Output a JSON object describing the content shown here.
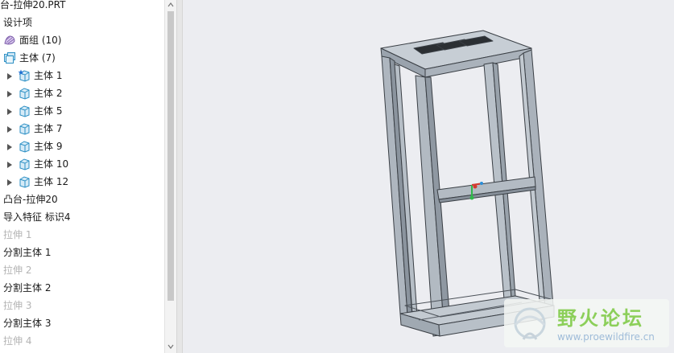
{
  "model_tree": {
    "items": [
      {
        "label": "台-拉伸20.PRT",
        "dim": false
      },
      {
        "label": "设计项",
        "dim": false
      },
      {
        "label": "面组 (10)",
        "dim": false
      },
      {
        "label": "主体 (7)",
        "dim": false
      },
      {
        "label": "主体 1",
        "dim": false
      },
      {
        "label": "主体 2",
        "dim": false
      },
      {
        "label": "主体 5",
        "dim": false
      },
      {
        "label": "主体 7",
        "dim": false
      },
      {
        "label": "主体 9",
        "dim": false
      },
      {
        "label": "主体 10",
        "dim": false
      },
      {
        "label": "主体 12",
        "dim": false
      },
      {
        "label": "凸台-拉伸20",
        "dim": false
      },
      {
        "label": "导入特征 标识4",
        "dim": false
      },
      {
        "label": "拉伸 1",
        "dim": true
      },
      {
        "label": "分割主体 1",
        "dim": false
      },
      {
        "label": "拉伸 2",
        "dim": true
      },
      {
        "label": "分割主体 2",
        "dim": false
      },
      {
        "label": "拉伸 3",
        "dim": true
      },
      {
        "label": "分割主体 3",
        "dim": false
      },
      {
        "label": "拉伸 4",
        "dim": true
      }
    ]
  },
  "icons": {
    "quilt": "quilt-icon",
    "body_group": "body-group-icon",
    "body": "body-icon",
    "body_active": "active-body-icon",
    "expand": "expand-arrow-icon"
  },
  "colors": {
    "frame_fill": "#b9c1c9",
    "frame_edge": "#3a3f45",
    "viewport_bg": "#ecedf1",
    "dim_text": "#b4b4b4",
    "watermark_green": "#8ccf5a",
    "watermark_blue": "#9fbcd9"
  },
  "watermark": {
    "title": "野火论坛",
    "url": "www.proewildfire.cn"
  }
}
